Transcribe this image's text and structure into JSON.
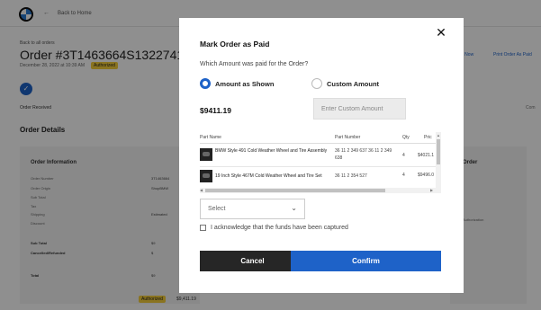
{
  "background": {
    "top_link": "Back to Home",
    "back_link": "Back to all orders",
    "order_title": "Order #3T1463664S1322741",
    "order_date": "December 28, 2022 at 10:39 AM",
    "status_badge": "Authorized",
    "right_links": [
      "Capture Now",
      "Print Order As Paid"
    ],
    "step_label": "Order Received",
    "step_label_right": "Com",
    "section_title": "Order Details",
    "card_title": "Order Information",
    "card_rows": [
      {
        "label": "Order Number",
        "value": "3T1463664"
      },
      {
        "label": "Order Origin",
        "value": "ShopBMW"
      },
      {
        "label": "Sub Total",
        "value": ""
      },
      {
        "label": "Tax",
        "value": ""
      },
      {
        "label": "Shipping",
        "value": "Estimated"
      },
      {
        "label": "Discount",
        "value": ""
      }
    ],
    "subtotal_label": "Sub Total",
    "subtotal_value": "$9",
    "cancelled_label": "Cancelled/Refunded",
    "cancelled_value": "$",
    "total_label": "Total",
    "total_value": "$9",
    "right_card_title": "Order",
    "right_card_text": "Authorization",
    "bottom_badge": "Authorized",
    "bottom_amount": "$9,411.19"
  },
  "modal": {
    "title": "Mark Order as Paid",
    "close_icon": "close-icon",
    "question": "Which Amount was paid for the Order?",
    "radio_amount_shown": "Amount as Shown",
    "radio_custom_amount": "Custom Amount",
    "selected_option": "Amount as Shown",
    "amount": "$9411.19",
    "custom_placeholder": "Enter Custom Amount",
    "table": {
      "headers": [
        "Part Name",
        "Part Number",
        "Qty",
        "Pric"
      ],
      "rows": [
        {
          "name": "BMW Style 491 Cold Weather Wheel and Tire Assembly",
          "number": "36 11 2 349 637 36 11 2 349 638",
          "qty": "4",
          "price": "$4021.1"
        },
        {
          "name": "19 Inch Style 467M Cold Weather Wheel and Tire Set",
          "number": "36 11 2 354 527",
          "qty": "4",
          "price": "$9496.0"
        }
      ]
    },
    "select_placeholder": "Select",
    "acknowledge_label": "I acknowledge that the funds have been captured",
    "cancel_label": "Cancel",
    "confirm_label": "Confirm"
  },
  "colors": {
    "accent": "#1e62c8",
    "dark_button": "#262626",
    "badge": "#f6cf3a",
    "overlay": "rgba(0,0,0,0.44)"
  }
}
